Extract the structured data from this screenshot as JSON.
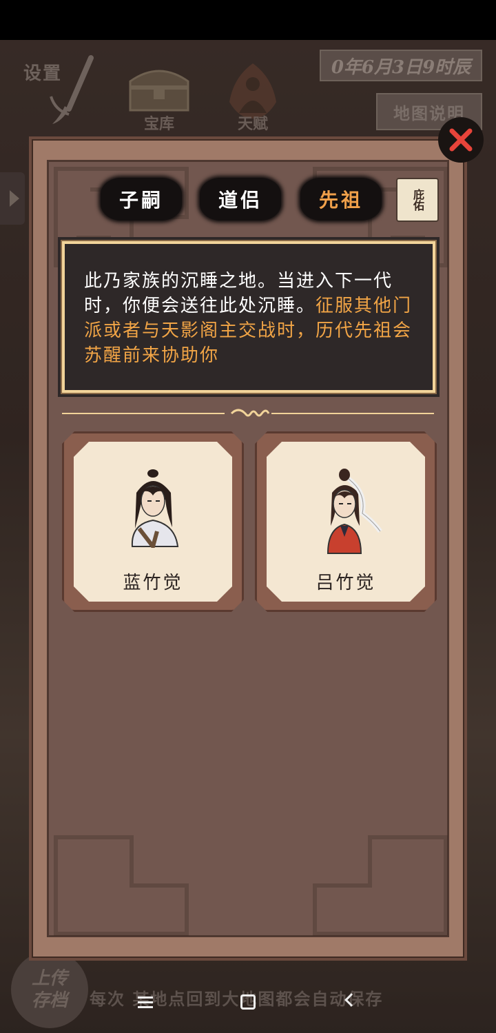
{
  "hud": {
    "settings_label": "设置",
    "treasury_label": "宝库",
    "talent_label": "天赋",
    "date": "0年6月3日9时辰",
    "map_note": "地图说明",
    "upload_label_1": "上传",
    "upload_label_2": "存档",
    "autosave_text": "每次 某地点回到大地图都会自动保存"
  },
  "dialog": {
    "tabs": [
      {
        "label": "子嗣"
      },
      {
        "label": "道侣"
      },
      {
        "label": "先祖"
      }
    ],
    "scroll_tab_label": "庇佑",
    "description_white": "此乃家族的沉睡之地。当进入下一代时，你便会送往此处沉睡。",
    "description_highlight": "征服其他门派或者与天影阁主交战时，历代先祖会苏醒前来协助你",
    "ancestors": [
      {
        "name": "蓝竹觉"
      },
      {
        "name": "吕竹觉"
      }
    ]
  },
  "colors": {
    "active_tab": "#f0a04a",
    "highlight_text": "#f2a546",
    "desc_border": "#f2d49a",
    "card_face": "#f4e7d2",
    "close_x": "#e8443a"
  }
}
